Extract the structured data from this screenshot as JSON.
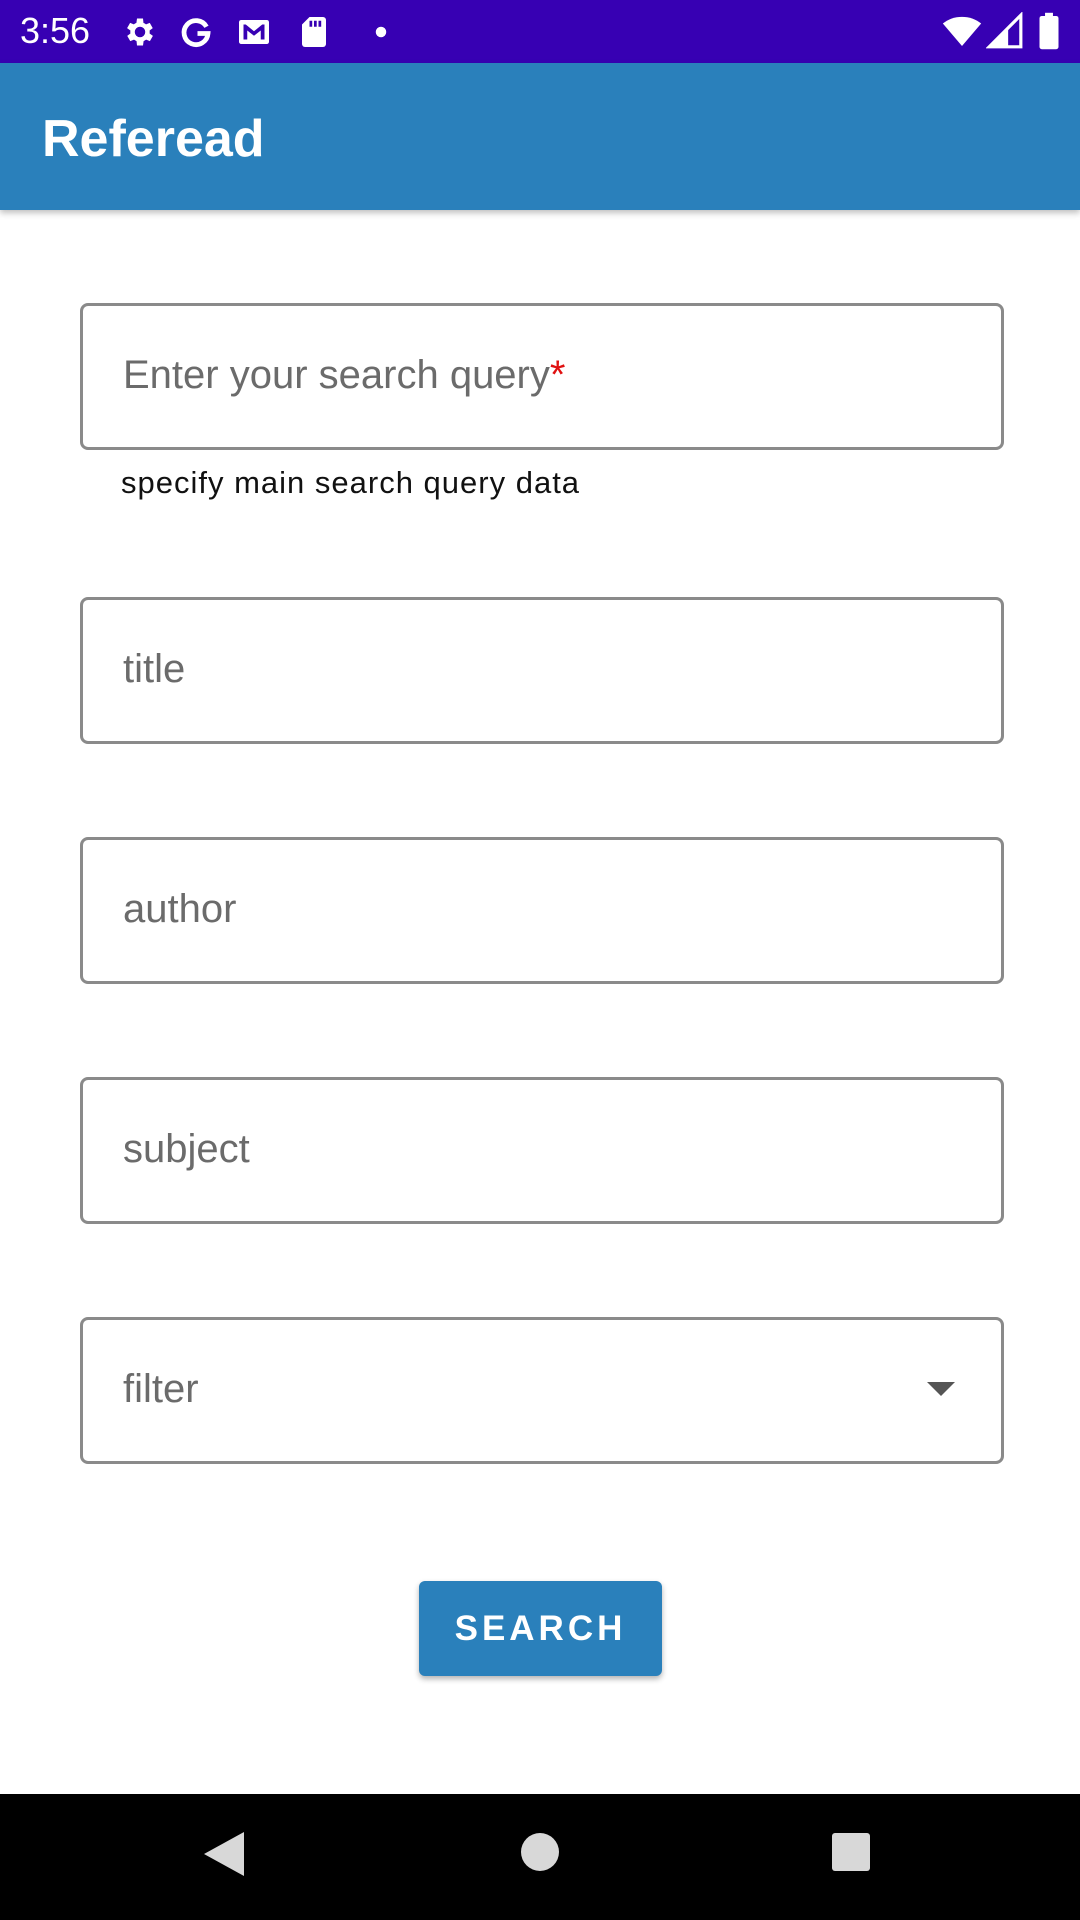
{
  "status_bar": {
    "time": "3:56",
    "left_icons": [
      "gear-icon",
      "google-icon",
      "gmail-icon",
      "sd-card-icon",
      "dot-icon"
    ],
    "right_icons": [
      "wifi-icon",
      "signal-icon",
      "battery-icon"
    ],
    "background_color": "#3700b3"
  },
  "app_bar": {
    "title": "Referead",
    "background_color": "#2a80bb"
  },
  "form": {
    "query": {
      "placeholder": "Enter your search query",
      "required_marker": "*",
      "helper_text": "specify main search query data"
    },
    "title_field": {
      "placeholder": "title"
    },
    "author_field": {
      "placeholder": "author"
    },
    "subject_field": {
      "placeholder": "subject"
    },
    "filter_select": {
      "placeholder": "filter",
      "icon": "dropdown-arrow-icon"
    },
    "search_button_label": "SEARCH"
  },
  "nav_bar": {
    "icons": [
      "back-icon",
      "home-icon",
      "recents-icon"
    ]
  }
}
